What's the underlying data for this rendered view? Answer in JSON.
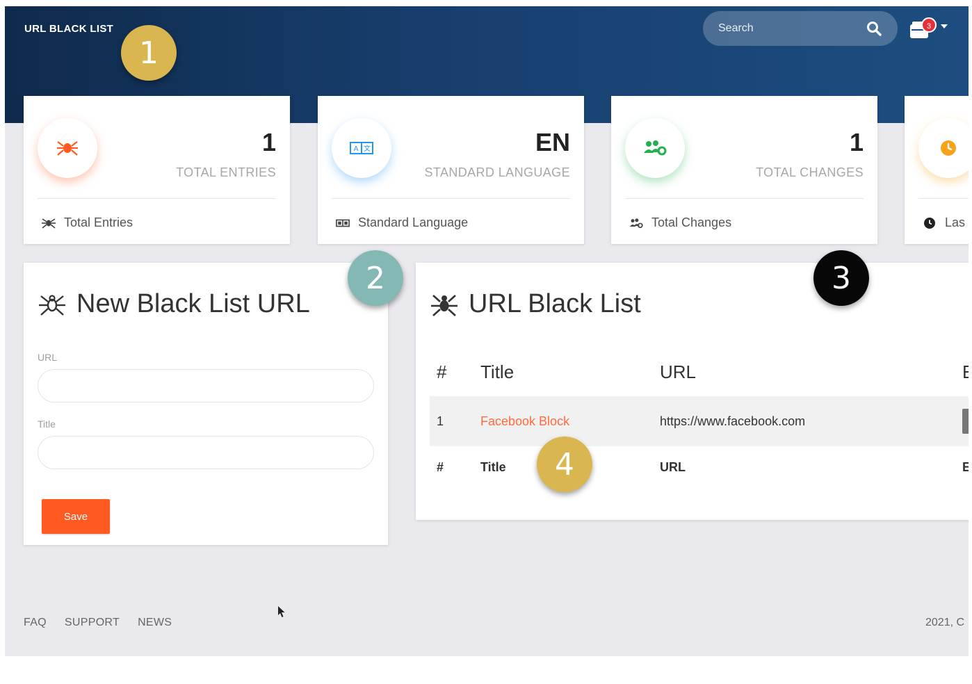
{
  "header": {
    "brand": "URL BLACK LIST",
    "search_placeholder": "Search",
    "notification_count": "3"
  },
  "stats": [
    {
      "value": "1",
      "label": "TOTAL ENTRIES",
      "footer": "Total Entries",
      "color": "#ff5a1f",
      "icon": "spider-icon"
    },
    {
      "value": "EN",
      "label": "STANDARD LANGUAGE",
      "footer": "Standard Language",
      "color": "#2196f3",
      "icon": "language-icon"
    },
    {
      "value": "1",
      "label": "TOTAL CHANGES",
      "footer": "Total Changes",
      "color": "#22b14c",
      "icon": "users-gear-icon"
    },
    {
      "value": "",
      "label": "",
      "footer": "Las",
      "color": "#f7a21b",
      "icon": "clock-icon"
    }
  ],
  "new_entry": {
    "title": "New Black List URL",
    "url_label": "URL",
    "title_label": "Title",
    "save_label": "Save"
  },
  "list": {
    "title": "URL Black List",
    "columns": [
      "#",
      "Title",
      "URL",
      "E"
    ],
    "rows": [
      {
        "num": "1",
        "title": "Facebook Block",
        "url": "https://www.facebook.com"
      }
    ],
    "footer_columns": [
      "#",
      "Title",
      "URL",
      "E"
    ]
  },
  "footer": {
    "links": [
      "FAQ",
      "SUPPORT",
      "NEWS"
    ],
    "copyright": "2021, C"
  },
  "markers": [
    "1",
    "2",
    "3",
    "4"
  ]
}
